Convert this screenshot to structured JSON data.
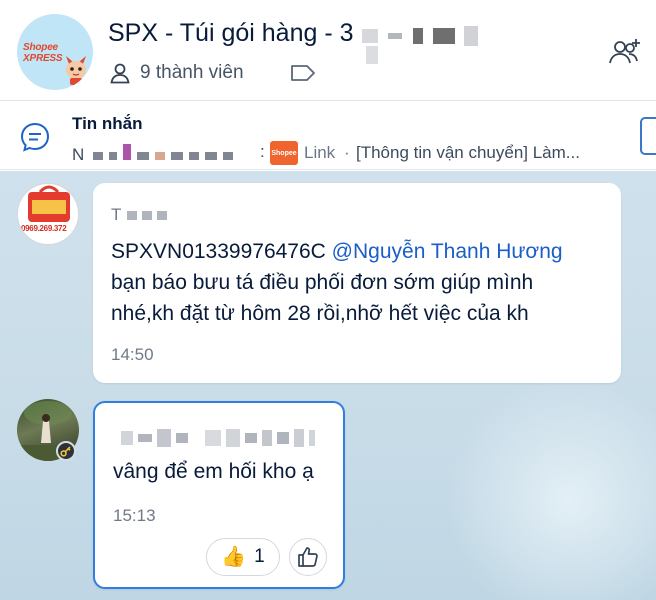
{
  "header": {
    "title": "SPX - Túi gói hàng - 3",
    "member_count": "9 thành viên",
    "group_avatar_brand": "Shopee XPRESS"
  },
  "pinned": {
    "title": "Tin nhắn",
    "sender_initial": "N",
    "separator": ":",
    "shopee_badge": "Shopee",
    "link_label": "Link",
    "dot": "·",
    "preview": "[Thông tin vận chuyển] Làm..."
  },
  "messages": [
    {
      "sender_initial": "T",
      "lines": [
        {
          "before": "SPXVN01339976476C ",
          "mention": "@Nguyễn Thanh Hương"
        },
        {
          "before": " bạn báo bưu tá điều phối đơn sớm giúp mình"
        },
        {
          "before": "nhé,kh đặt từ hôm 28 rồi,nhỡ hết việc của kh"
        }
      ],
      "time": "14:50",
      "avatar_text": "0969.269.372"
    },
    {
      "text": "vâng để em hối kho ạ",
      "time": "15:13",
      "reaction": {
        "emoji": "👍",
        "count": "1"
      }
    }
  ],
  "colors": {
    "accent": "#2f7ee0",
    "mention": "#1a5ec8",
    "chat_background": "#c8dce8",
    "shopee_orange": "#f0642e"
  },
  "icons": {
    "members": "person-icon",
    "tag": "tag-icon",
    "add_member": "add-member-icon",
    "pinned": "message-icon",
    "react": "thumbs-up-icon"
  }
}
